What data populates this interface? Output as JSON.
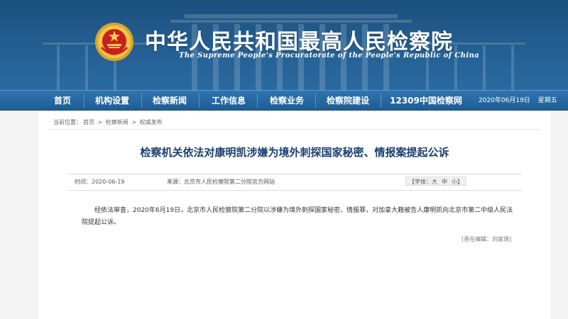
{
  "header": {
    "title_cn": "中华人民共和国最高人民检察院",
    "title_en": "The Supreme People's Procuratorate of the People's Republic of China",
    "emblem_icon": "procuratorate-emblem-icon"
  },
  "nav": {
    "items": [
      "首页",
      "机构设置",
      "检察新闻",
      "工作信息",
      "检察业务",
      "检察院建设",
      "12309中国检察网"
    ],
    "date": "2020年06月19日",
    "weekday": "星期五"
  },
  "breadcrumb": {
    "prefix": "当前位置：",
    "items": [
      "首页",
      "检察新闻",
      "权威发布"
    ],
    "separator": ">"
  },
  "article": {
    "title": "检察机关依法对康明凯涉嫌为境外刺探国家秘密、情报案提起公诉",
    "time_label": "时间：",
    "time": "2020-06-19",
    "source_label": "来源：",
    "source": "北京市人民检察院第二分院官方网站",
    "font_label": "【字体：",
    "font_options": [
      "大",
      "中",
      "小"
    ],
    "font_close": "】",
    "body": "经依法审查，2020年6月19日，北京市人民检察院第二分院以涉嫌为境外刺探国家秘密、情报罪，对加拿大籍被告人康明凯向北京市第二中级人民法院提起公诉。",
    "editor": "[责任编辑：刘家璟]"
  },
  "colors": {
    "banner": "#235d8f",
    "nav": "#2a6aa5",
    "title": "#1a3f6e"
  }
}
